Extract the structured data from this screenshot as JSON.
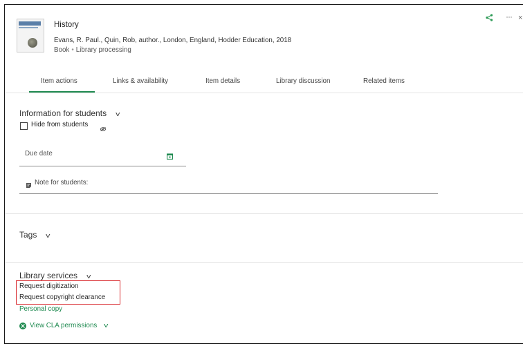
{
  "item": {
    "title": "History",
    "authors_publisher": "Evans, R. Paul., Quin, Rob, author., London, England, Hodder Education, 2018",
    "type": "Book",
    "status": "Library processing"
  },
  "header_icons": [
    "share-icon",
    "more-icon",
    "close-icon"
  ],
  "tabs": [
    {
      "label": "Item actions",
      "active": true
    },
    {
      "label": "Links & availability"
    },
    {
      "label": "Item details"
    },
    {
      "label": "Library discussion"
    },
    {
      "label": "Related items"
    }
  ],
  "students": {
    "heading": "Information for students",
    "hide_label": "Hide from students",
    "hide_checked": false,
    "due_date_label": "Due date",
    "note_label": "Note for students:"
  },
  "tags": {
    "heading": "Tags"
  },
  "library_services": {
    "heading": "Library services",
    "request_digitization": "Request digitization",
    "request_copyright": "Request copyright clearance",
    "personal_copy": "Personal copy",
    "view_cla": "View CLA permissions"
  },
  "colors": {
    "accent": "#1f8a50",
    "highlight_border": "#d8262b"
  }
}
